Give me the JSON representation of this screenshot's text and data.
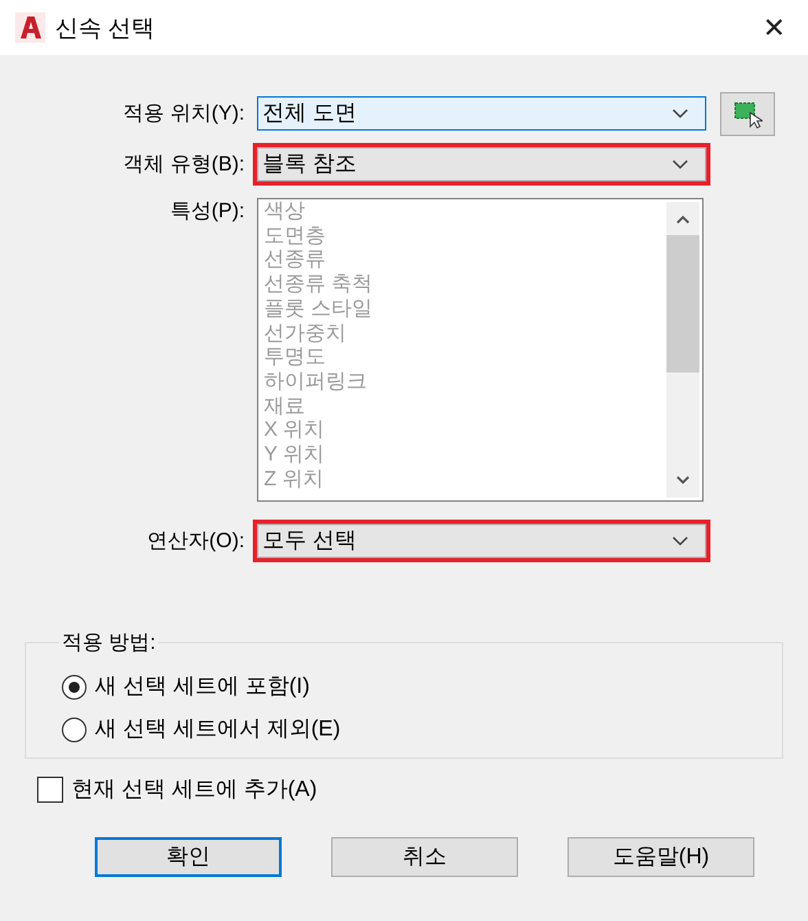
{
  "window": {
    "title": "신속 선택",
    "close": "✕"
  },
  "fields": [
    {
      "label": "적용 위치(Y):",
      "value": "전체 도면",
      "focused": true,
      "highlighted": false,
      "picker": true
    },
    {
      "label": "객체 유형(B):",
      "value": "블록 참조",
      "focused": false,
      "highlighted": true,
      "picker": false
    }
  ],
  "properties": {
    "label": "특성(P):",
    "disabled": true,
    "items": [
      "색상",
      "도면층",
      "선종류",
      "선종류 축척",
      "플롯 스타일",
      "선가중치",
      "투명도",
      "하이퍼링크",
      "재료",
      "X 위치",
      "Y 위치",
      "Z 위치"
    ]
  },
  "operator": {
    "label": "연산자(O):",
    "value": "모두 선택",
    "focused": false,
    "highlighted": true
  },
  "apply_mode": {
    "legend": "적용 방법:",
    "options": [
      {
        "label": "새 선택 세트에 포함(I)",
        "selected": true
      },
      {
        "label": "새 선택 세트에서 제외(E)",
        "selected": false
      }
    ]
  },
  "append": {
    "label": "현재 선택 세트에 추가(A)",
    "checked": false
  },
  "buttons": [
    {
      "label": "확인",
      "default": true
    },
    {
      "label": "취소",
      "default": false
    },
    {
      "label": "도움말(H)",
      "default": false
    }
  ]
}
